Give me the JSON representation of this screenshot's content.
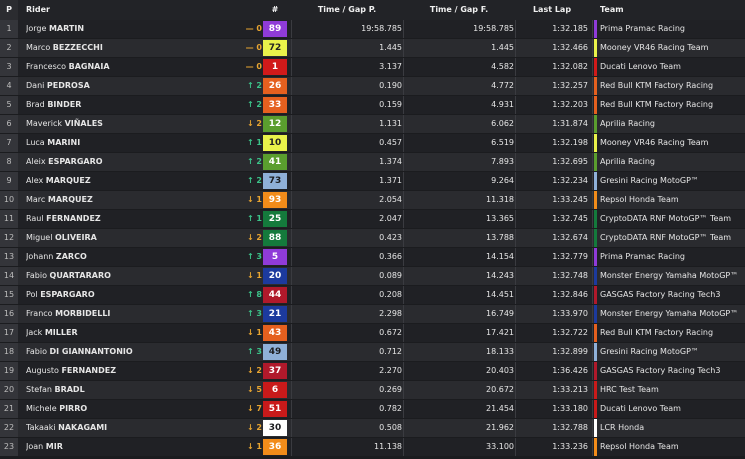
{
  "header": {
    "pos": "P",
    "rider": "Rider",
    "num": "#",
    "gap_p": "Time / Gap P.",
    "gap_f": "Time / Gap F.",
    "last_lap": "Last Lap",
    "team": "Team"
  },
  "colors": {
    "up": "#3cc48a",
    "down": "#e8a531",
    "neutral": "#e8a531"
  },
  "rows": [
    {
      "pos": "1",
      "first": "Jorge",
      "last": "MARTIN",
      "chg": "— 0",
      "dir": "eq",
      "num": "89",
      "num_bg": "#8f3bd8",
      "num_fg": "#ffffff",
      "gap_p": "19:58.785",
      "gap_f": "19:58.785",
      "last_lap": "1:32.185",
      "team": "Prima Pramac Racing",
      "team_color": "#8f3bd8"
    },
    {
      "pos": "2",
      "first": "Marco",
      "last": "BEZZECCHI",
      "chg": "— 0",
      "dir": "eq",
      "num": "72",
      "num_bg": "#e9f24a",
      "num_fg": "#222222",
      "gap_p": "1.445",
      "gap_f": "1.445",
      "last_lap": "1:32.466",
      "team": "Mooney VR46 Racing Team",
      "team_color": "#e9f24a"
    },
    {
      "pos": "3",
      "first": "Francesco",
      "last": "BAGNAIA",
      "chg": "— 0",
      "dir": "eq",
      "num": "1",
      "num_bg": "#d11a1a",
      "num_fg": "#ffffff",
      "gap_p": "3.137",
      "gap_f": "4.582",
      "last_lap": "1:32.082",
      "team": "Ducati Lenovo Team",
      "team_color": "#d11a1a"
    },
    {
      "pos": "4",
      "first": "Dani",
      "last": "PEDROSA",
      "chg": "↑ 2",
      "dir": "up",
      "num": "26",
      "num_bg": "#e5601f",
      "num_fg": "#ffffff",
      "gap_p": "0.190",
      "gap_f": "4.772",
      "last_lap": "1:32.257",
      "team": "Red Bull KTM Factory Racing",
      "team_color": "#e5601f"
    },
    {
      "pos": "5",
      "first": "Brad",
      "last": "BINDER",
      "chg": "↑ 2",
      "dir": "up",
      "num": "33",
      "num_bg": "#e5601f",
      "num_fg": "#ffffff",
      "gap_p": "0.159",
      "gap_f": "4.931",
      "last_lap": "1:32.203",
      "team": "Red Bull KTM Factory Racing",
      "team_color": "#e5601f"
    },
    {
      "pos": "6",
      "first": "Maverick",
      "last": "VIÑALES",
      "chg": "↓ 2",
      "dir": "down",
      "num": "12",
      "num_bg": "#5a9e2e",
      "num_fg": "#ffffff",
      "gap_p": "1.131",
      "gap_f": "6.062",
      "last_lap": "1:31.874",
      "team": "Aprilia Racing",
      "team_color": "#5a9e2e"
    },
    {
      "pos": "7",
      "first": "Luca",
      "last": "MARINI",
      "chg": "↑ 1",
      "dir": "up",
      "num": "10",
      "num_bg": "#e9f24a",
      "num_fg": "#222222",
      "gap_p": "0.457",
      "gap_f": "6.519",
      "last_lap": "1:32.198",
      "team": "Mooney VR46 Racing Team",
      "team_color": "#e9f24a"
    },
    {
      "pos": "8",
      "first": "Aleix",
      "last": "ESPARGARO",
      "chg": "↑ 2",
      "dir": "up",
      "num": "41",
      "num_bg": "#5a9e2e",
      "num_fg": "#ffffff",
      "gap_p": "1.374",
      "gap_f": "7.893",
      "last_lap": "1:32.695",
      "team": "Aprilia Racing",
      "team_color": "#5a9e2e"
    },
    {
      "pos": "9",
      "first": "Alex",
      "last": "MARQUEZ",
      "chg": "↑ 2",
      "dir": "up",
      "num": "73",
      "num_bg": "#8fb0d8",
      "num_fg": "#1b1c1f",
      "gap_p": "1.371",
      "gap_f": "9.264",
      "last_lap": "1:32.234",
      "team": "Gresini Racing MotoGP™",
      "team_color": "#8fb0d8"
    },
    {
      "pos": "10",
      "first": "Marc",
      "last": "MARQUEZ",
      "chg": "↓ 1",
      "dir": "down",
      "num": "93",
      "num_bg": "#f28c1a",
      "num_fg": "#ffffff",
      "gap_p": "2.054",
      "gap_f": "11.318",
      "last_lap": "1:33.245",
      "team": "Repsol Honda Team",
      "team_color": "#f28c1a"
    },
    {
      "pos": "11",
      "first": "Raul",
      "last": "FERNANDEZ",
      "chg": "↑ 1",
      "dir": "up",
      "num": "25",
      "num_bg": "#147a3c",
      "num_fg": "#ffffff",
      "gap_p": "2.047",
      "gap_f": "13.365",
      "last_lap": "1:32.745",
      "team": "CryptoDATA RNF MotoGP™ Team",
      "team_color": "#147a3c"
    },
    {
      "pos": "12",
      "first": "Miguel",
      "last": "OLIVEIRA",
      "chg": "↓ 2",
      "dir": "down",
      "num": "88",
      "num_bg": "#147a3c",
      "num_fg": "#ffffff",
      "gap_p": "0.423",
      "gap_f": "13.788",
      "last_lap": "1:32.674",
      "team": "CryptoDATA RNF MotoGP™ Team",
      "team_color": "#147a3c"
    },
    {
      "pos": "13",
      "first": "Johann",
      "last": "ZARCO",
      "chg": "↑ 3",
      "dir": "up",
      "num": "5",
      "num_bg": "#8f3bd8",
      "num_fg": "#ffffff",
      "gap_p": "0.366",
      "gap_f": "14.154",
      "last_lap": "1:32.779",
      "team": "Prima Pramac Racing",
      "team_color": "#8f3bd8"
    },
    {
      "pos": "14",
      "first": "Fabio",
      "last": "QUARTARARO",
      "chg": "↓ 1",
      "dir": "down",
      "num": "20",
      "num_bg": "#1c3a9e",
      "num_fg": "#ffffff",
      "gap_p": "0.089",
      "gap_f": "14.243",
      "last_lap": "1:32.748",
      "team": "Monster Energy Yamaha MotoGP™",
      "team_color": "#1c3a9e"
    },
    {
      "pos": "15",
      "first": "Pol",
      "last": "ESPARGARO",
      "chg": "↑ 8",
      "dir": "up",
      "num": "44",
      "num_bg": "#b0192b",
      "num_fg": "#ffffff",
      "gap_p": "0.208",
      "gap_f": "14.451",
      "last_lap": "1:32.846",
      "team": "GASGAS Factory Racing Tech3",
      "team_color": "#b0192b"
    },
    {
      "pos": "16",
      "first": "Franco",
      "last": "MORBIDELLI",
      "chg": "↑ 3",
      "dir": "up",
      "num": "21",
      "num_bg": "#1c3a9e",
      "num_fg": "#ffffff",
      "gap_p": "2.298",
      "gap_f": "16.749",
      "last_lap": "1:33.970",
      "team": "Monster Energy Yamaha MotoGP™",
      "team_color": "#1c3a9e"
    },
    {
      "pos": "17",
      "first": "Jack",
      "last": "MILLER",
      "chg": "↓ 1",
      "dir": "down",
      "num": "43",
      "num_bg": "#e5601f",
      "num_fg": "#ffffff",
      "gap_p": "0.672",
      "gap_f": "17.421",
      "last_lap": "1:32.722",
      "team": "Red Bull KTM Factory Racing",
      "team_color": "#e5601f"
    },
    {
      "pos": "18",
      "first": "Fabio",
      "last": "DI GIANNANTONIO",
      "chg": "↑ 3",
      "dir": "up",
      "num": "49",
      "num_bg": "#8fb0d8",
      "num_fg": "#1b1c1f",
      "gap_p": "0.712",
      "gap_f": "18.133",
      "last_lap": "1:32.899",
      "team": "Gresini Racing MotoGP™",
      "team_color": "#8fb0d8"
    },
    {
      "pos": "19",
      "first": "Augusto",
      "last": "FERNANDEZ",
      "chg": "↓ 2",
      "dir": "down",
      "num": "37",
      "num_bg": "#b0192b",
      "num_fg": "#ffffff",
      "gap_p": "2.270",
      "gap_f": "20.403",
      "last_lap": "1:36.426",
      "team": "GASGAS Factory Racing Tech3",
      "team_color": "#b0192b"
    },
    {
      "pos": "20",
      "first": "Stefan",
      "last": "BRADL",
      "chg": "↓ 5",
      "dir": "down",
      "num": "6",
      "num_bg": "#c81a1a",
      "num_fg": "#ffffff",
      "gap_p": "0.269",
      "gap_f": "20.672",
      "last_lap": "1:33.213",
      "team": "HRC Test Team",
      "team_color": "#c81a1a"
    },
    {
      "pos": "21",
      "first": "Michele",
      "last": "PIRRO",
      "chg": "↓ 7",
      "dir": "down",
      "num": "51",
      "num_bg": "#c81a1a",
      "num_fg": "#ffffff",
      "gap_p": "0.782",
      "gap_f": "21.454",
      "last_lap": "1:33.180",
      "team": "Ducati Lenovo Team",
      "team_color": "#c81a1a"
    },
    {
      "pos": "22",
      "first": "Takaaki",
      "last": "NAKAGAMI",
      "chg": "↓ 2",
      "dir": "down",
      "num": "30",
      "num_bg": "#ffffff",
      "num_fg": "#1b1c1f",
      "gap_p": "0.508",
      "gap_f": "21.962",
      "last_lap": "1:32.788",
      "team": "LCR Honda",
      "team_color": "#ffffff"
    },
    {
      "pos": "23",
      "first": "Joan",
      "last": "MIR",
      "chg": "↓ 1",
      "dir": "down",
      "num": "36",
      "num_bg": "#f28c1a",
      "num_fg": "#ffffff",
      "gap_p": "11.138",
      "gap_f": "33.100",
      "last_lap": "1:33.236",
      "team": "Repsol Honda Team",
      "team_color": "#f28c1a"
    }
  ]
}
